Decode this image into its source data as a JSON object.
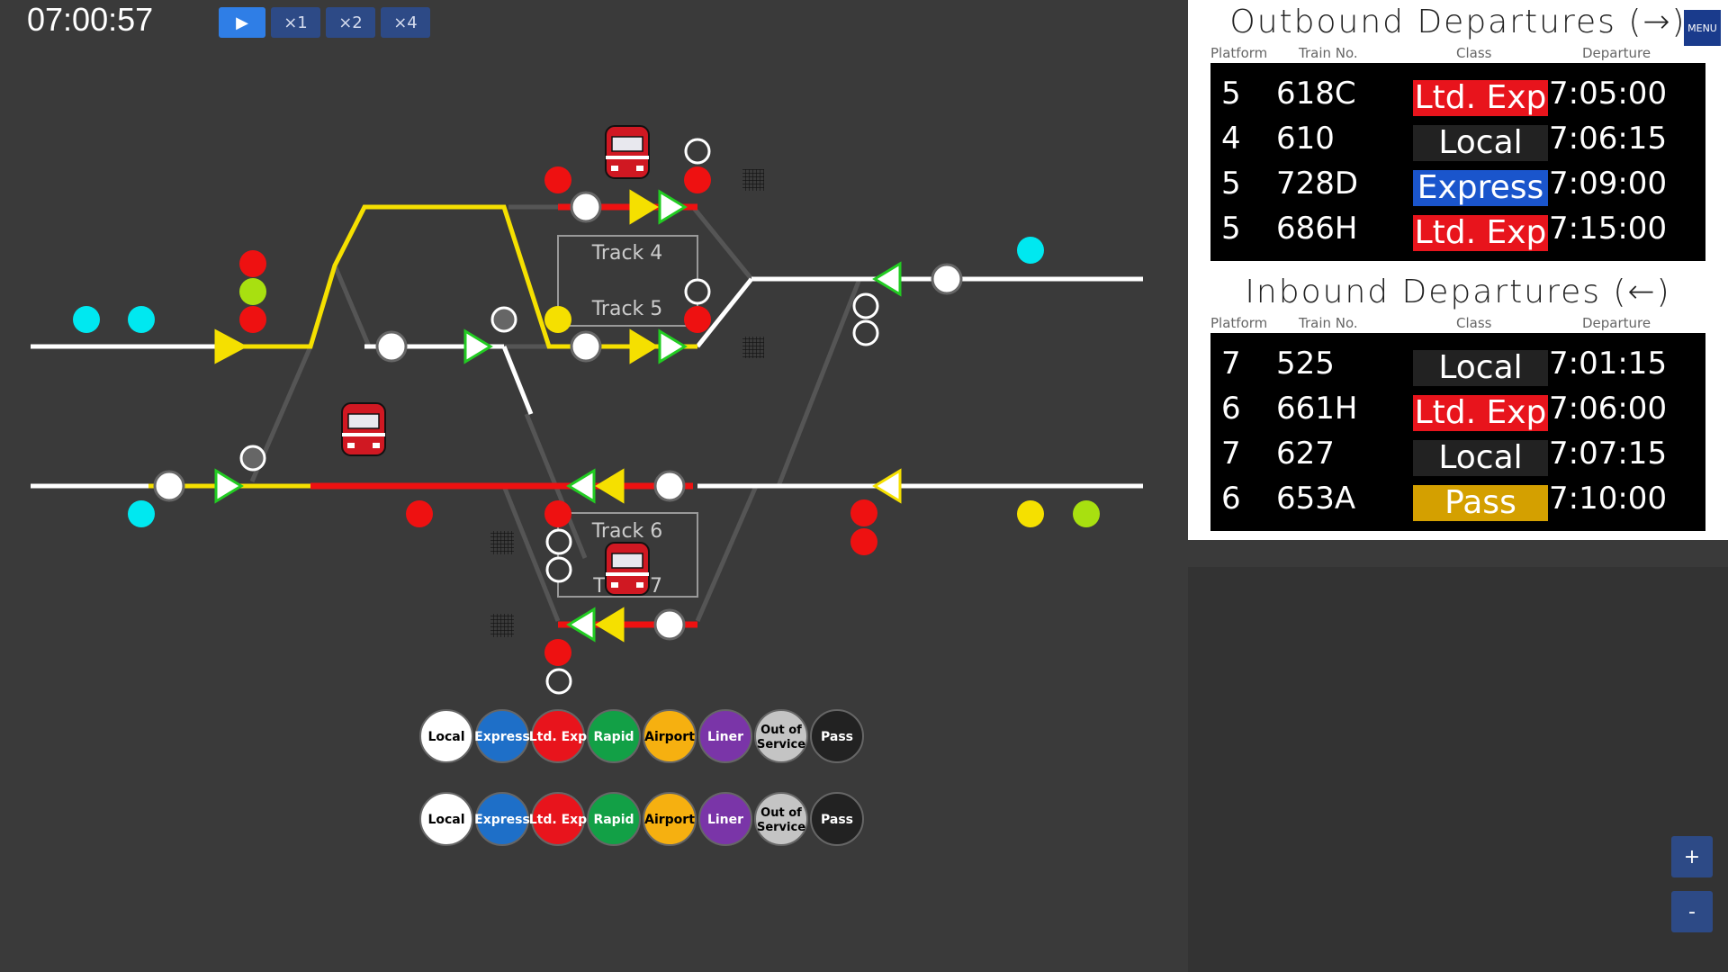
{
  "clock": "07:00:57",
  "speed": {
    "play": "▶",
    "x1": "×1",
    "x2": "×2",
    "x4": "×4"
  },
  "menu_label": "MENU",
  "zoom": {
    "in": "+",
    "out": "-"
  },
  "track_labels": [
    "Track 4",
    "Track 5",
    "Track 6",
    "T",
    "7"
  ],
  "legend_rows": [
    [
      {
        "label": "Local",
        "bg": "#ffffff",
        "fg": "#000000"
      },
      {
        "label": "Express",
        "bg": "#1e6fc8",
        "fg": "#ffffff"
      },
      {
        "label": "Ltd. Exp",
        "bg": "#e8141c",
        "fg": "#ffffff"
      },
      {
        "label": "Rapid",
        "bg": "#12a046",
        "fg": "#ffffff"
      },
      {
        "label": "Airport",
        "bg": "#f6b010",
        "fg": "#000000"
      },
      {
        "label": "Liner",
        "bg": "#7a35a8",
        "fg": "#ffffff"
      },
      {
        "label": "Out of Service",
        "bg": "#c4c4c4",
        "fg": "#000000"
      },
      {
        "label": "Pass",
        "bg": "#222222",
        "fg": "#ffffff"
      }
    ],
    [
      {
        "label": "Local",
        "bg": "#ffffff",
        "fg": "#000000"
      },
      {
        "label": "Express",
        "bg": "#1e6fc8",
        "fg": "#ffffff"
      },
      {
        "label": "Ltd. Exp",
        "bg": "#e8141c",
        "fg": "#ffffff"
      },
      {
        "label": "Rapid",
        "bg": "#12a046",
        "fg": "#ffffff"
      },
      {
        "label": "Airport",
        "bg": "#f6b010",
        "fg": "#000000"
      },
      {
        "label": "Liner",
        "bg": "#7a35a8",
        "fg": "#ffffff"
      },
      {
        "label": "Out of Service",
        "bg": "#c4c4c4",
        "fg": "#000000"
      },
      {
        "label": "Pass",
        "bg": "#222222",
        "fg": "#ffffff"
      }
    ]
  ],
  "headers": {
    "platform": "Platform",
    "train_no": "Train No.",
    "class": "Class",
    "departure": "Departure"
  },
  "outbound": {
    "title": "Outbound Departures (→)",
    "rows": [
      {
        "platform": "5",
        "train_no": "618C",
        "class": "Ltd. Exp",
        "class_color": "#e8141c",
        "departure": "7:05:00"
      },
      {
        "platform": "4",
        "train_no": "610",
        "class": "Local",
        "class_color": "#222222",
        "departure": "7:06:15"
      },
      {
        "platform": "5",
        "train_no": "728D",
        "class": "Express",
        "class_color": "#1a55cc",
        "departure": "7:09:00"
      },
      {
        "platform": "5",
        "train_no": "686H",
        "class": "Ltd. Exp",
        "class_color": "#e8141c",
        "departure": "7:15:00"
      }
    ]
  },
  "inbound": {
    "title": "Inbound Departures (←)",
    "rows": [
      {
        "platform": "7",
        "train_no": "525",
        "class": "Local",
        "class_color": "#222222",
        "departure": "7:01:15"
      },
      {
        "platform": "6",
        "train_no": "661H",
        "class": "Ltd. Exp",
        "class_color": "#e8141c",
        "departure": "7:06:00"
      },
      {
        "platform": "7",
        "train_no": "627",
        "class": "Local",
        "class_color": "#222222",
        "departure": "7:07:15"
      },
      {
        "platform": "6",
        "train_no": "653A",
        "class": "Pass",
        "class_color": "#d4a000",
        "departure": "7:10:00"
      }
    ]
  },
  "colors": {
    "track_idle": "#ffffff",
    "track_route": "#f5e000",
    "track_occupied": "#ee1111",
    "track_grey": "#555555",
    "signal_red": "#ee1111",
    "signal_green": "#a8e010",
    "signal_cyan": "#00e8f0",
    "signal_yellow": "#f5e000"
  }
}
